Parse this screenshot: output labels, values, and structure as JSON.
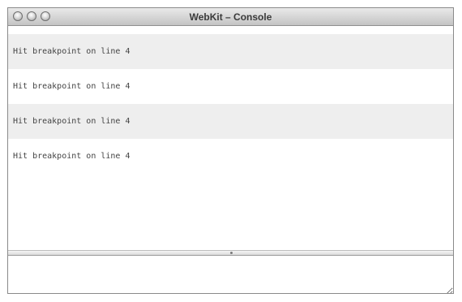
{
  "window": {
    "title": "WebKit – Console"
  },
  "console": {
    "messages": [
      "Hit breakpoint on line 4",
      "Hit breakpoint on line 4",
      "Hit breakpoint on line 4",
      "Hit breakpoint on line 4"
    ],
    "input_value": ""
  },
  "icons": {
    "close": "close-button-icon",
    "minimize": "minimize-button-icon",
    "zoom": "zoom-button-icon",
    "splitter": "splitter-grip-icon"
  },
  "colors": {
    "titlebar": "#d4d4d4",
    "row_shaded": "#eeeeee",
    "text": "#444444"
  }
}
